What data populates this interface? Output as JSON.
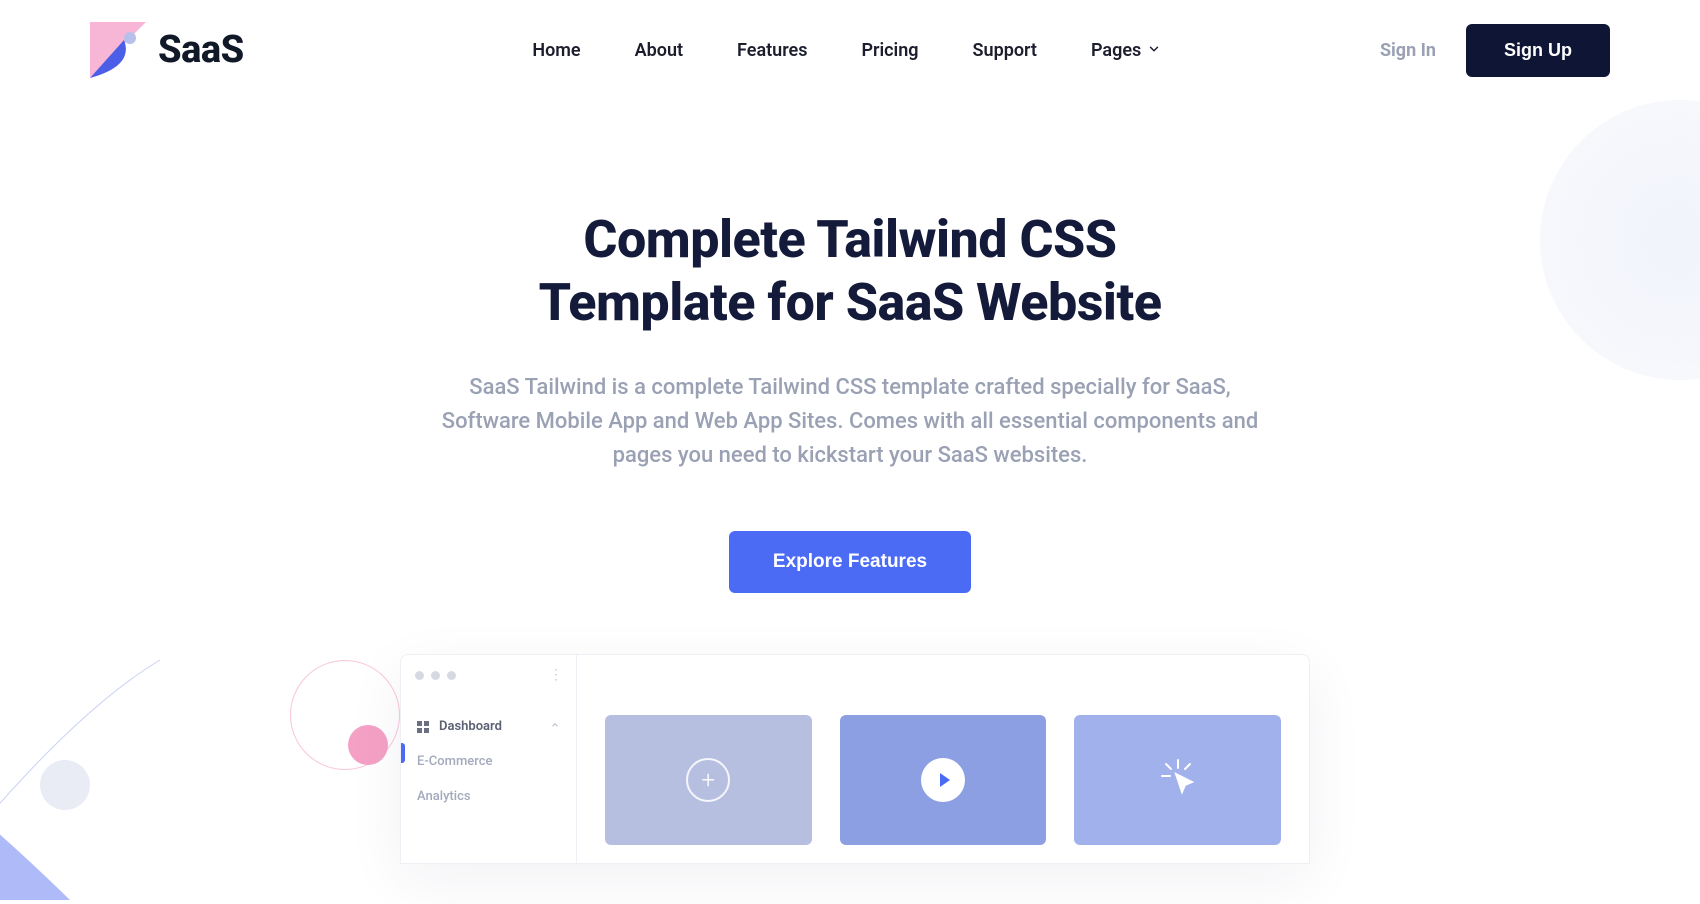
{
  "brand": {
    "name": "SaaS"
  },
  "nav": {
    "items": [
      {
        "label": "Home"
      },
      {
        "label": "About"
      },
      {
        "label": "Features"
      },
      {
        "label": "Pricing"
      },
      {
        "label": "Support"
      },
      {
        "label": "Pages"
      }
    ]
  },
  "auth": {
    "signin": "Sign In",
    "signup": "Sign Up"
  },
  "hero": {
    "title_line1": "Complete Tailwind CSS",
    "title_line2": "Template for SaaS Website",
    "subtitle": "SaaS Tailwind is a complete Tailwind CSS template crafted specially for SaaS, Software Mobile App and Web App Sites. Comes with all essential components and pages you need to kickstart your SaaS websites.",
    "cta": "Explore Features"
  },
  "mock": {
    "sidebar": {
      "items": [
        {
          "label": "Dashboard"
        },
        {
          "label": "E-Commerce"
        },
        {
          "label": "Analytics"
        }
      ]
    }
  }
}
